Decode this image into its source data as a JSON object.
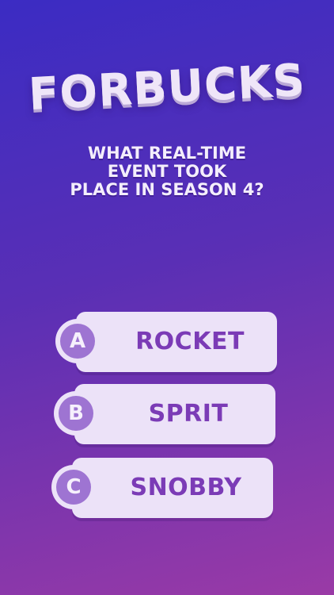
{
  "app": {
    "title": "FORBUCKS"
  },
  "question": {
    "lines": [
      "WHAT REAL-TIME",
      "EVENT TOOK",
      "PLACE IN SEASON 4?"
    ]
  },
  "answers": [
    {
      "letter": "A",
      "text": "ROCKET"
    },
    {
      "letter": "B",
      "text": "SPRIT"
    },
    {
      "letter": "C",
      "text": "SNOBBY"
    }
  ],
  "colors": {
    "background_top": "#3b2cc3",
    "background_bottom": "#9a3aa6",
    "card": "#ece2f8",
    "answer_text": "#7b3bb6",
    "badge": "#9e74d2"
  }
}
